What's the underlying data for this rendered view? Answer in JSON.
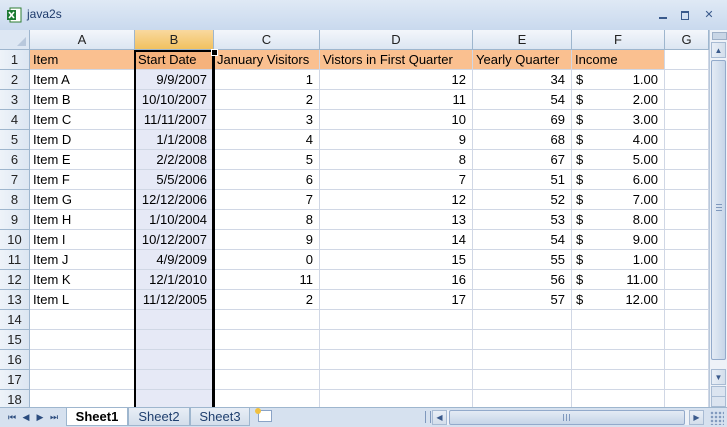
{
  "window": {
    "title": "java2s"
  },
  "columns": [
    "A",
    "B",
    "C",
    "D",
    "E",
    "F",
    "G"
  ],
  "rows": [
    "1",
    "2",
    "3",
    "4",
    "5",
    "6",
    "7",
    "8",
    "9",
    "10",
    "11",
    "12",
    "13",
    "14",
    "15",
    "16",
    "17",
    "18"
  ],
  "sheet": {
    "header": [
      "Item",
      "Start Date",
      "January Visitors",
      "Vistors in First Quarter",
      "Yearly Quarter",
      "Income"
    ],
    "currency_symbol": "$",
    "data": [
      [
        "Item A",
        "9/9/2007",
        "1",
        "12",
        "34",
        "1.00"
      ],
      [
        "Item B",
        "10/10/2007",
        "2",
        "11",
        "54",
        "2.00"
      ],
      [
        "Item C",
        "11/11/2007",
        "3",
        "10",
        "69",
        "3.00"
      ],
      [
        "Item D",
        "1/1/2008",
        "4",
        "9",
        "68",
        "4.00"
      ],
      [
        "Item E",
        "2/2/2008",
        "5",
        "8",
        "67",
        "5.00"
      ],
      [
        "Item F",
        "5/5/2006",
        "6",
        "7",
        "51",
        "6.00"
      ],
      [
        "Item G",
        "12/12/2006",
        "7",
        "12",
        "52",
        "7.00"
      ],
      [
        "Item H",
        "1/10/2004",
        "8",
        "13",
        "53",
        "8.00"
      ],
      [
        "Item I",
        "10/12/2007",
        "9",
        "14",
        "54",
        "9.00"
      ],
      [
        "Item J",
        "4/9/2009",
        "0",
        "15",
        "55",
        "1.00"
      ],
      [
        "Item K",
        "12/1/2010",
        "11",
        "16",
        "56",
        "11.00"
      ],
      [
        "Item L",
        "11/12/2005",
        "2",
        "17",
        "57",
        "12.00"
      ]
    ]
  },
  "selected_column": "B",
  "tabs": [
    {
      "label": "Sheet1",
      "active": true
    },
    {
      "label": "Sheet2",
      "active": false
    },
    {
      "label": "Sheet3",
      "active": false
    }
  ],
  "icons": {
    "app": "excel-icon",
    "minimize": "minimize-icon",
    "maximize": "maximize-icon",
    "close": "close-icon",
    "first_sheet": "first-sheet-icon",
    "prev_sheet": "prev-sheet-icon",
    "next_sheet": "next-sheet-icon",
    "last_sheet": "last-sheet-icon",
    "insert_sheet": "insert-sheet-icon"
  },
  "colors": {
    "header_fill": "#fac090",
    "selected_column_fill": "#e6e9f6",
    "selected_header": "#f1c15f",
    "grid_line": "#d0d7e5"
  }
}
